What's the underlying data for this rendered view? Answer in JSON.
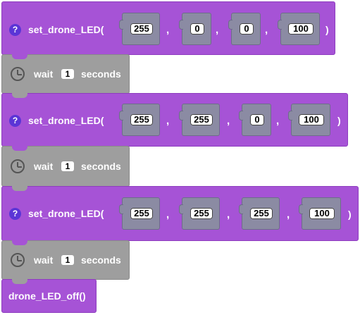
{
  "colors": {
    "purple_block": "#a653d6",
    "gray_block": "#9e9e9e",
    "help_icon": "#5b35d6",
    "socket": "#8b8ba3"
  },
  "blocks": [
    {
      "type": "set_drone_LED",
      "help": "?",
      "label": "set_drone_LED(",
      "close": ")",
      "args": [
        "255",
        "0",
        "0",
        "100"
      ]
    },
    {
      "type": "wait",
      "icon": "clock-icon",
      "label": "wait",
      "value": "1",
      "unit": "seconds"
    },
    {
      "type": "set_drone_LED",
      "help": "?",
      "label": "set_drone_LED(",
      "close": ")",
      "args": [
        "255",
        "255",
        "0",
        "100"
      ]
    },
    {
      "type": "wait",
      "icon": "clock-icon",
      "label": "wait",
      "value": "1",
      "unit": "seconds"
    },
    {
      "type": "set_drone_LED",
      "help": "?",
      "label": "set_drone_LED(",
      "close": ")",
      "args": [
        "255",
        "255",
        "255",
        "100"
      ]
    },
    {
      "type": "wait",
      "icon": "clock-icon",
      "label": "wait",
      "value": "1",
      "unit": "seconds"
    },
    {
      "type": "drone_LED_off",
      "label": "drone_LED_off()"
    }
  ],
  "separator": ","
}
